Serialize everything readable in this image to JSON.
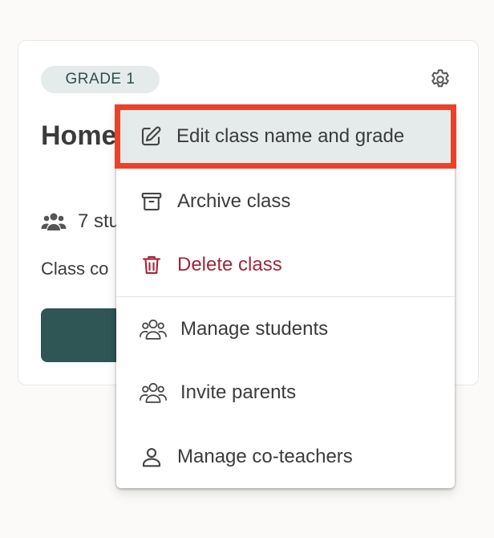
{
  "card": {
    "grade_badge": "GRADE 1",
    "title": "Home",
    "students_text": "7 stu",
    "class_code_text": "Class co"
  },
  "menu": {
    "items": [
      {
        "label": "Edit class name and grade",
        "icon": "pencil-square-icon",
        "selected": true
      },
      {
        "label": "Archive class",
        "icon": "archive-box-icon"
      },
      {
        "label": "Delete class",
        "icon": "trash-icon",
        "danger": true
      },
      {
        "label": "Manage students",
        "icon": "users-icon"
      },
      {
        "label": "Invite parents",
        "icon": "users-icon"
      },
      {
        "label": "Manage co-teachers",
        "icon": "user-icon"
      }
    ]
  },
  "colors": {
    "accent_dark_teal": "#2f5555",
    "badge_bg": "#e5ebea",
    "highlight_border": "#e8432a",
    "danger": "#a0283b"
  }
}
